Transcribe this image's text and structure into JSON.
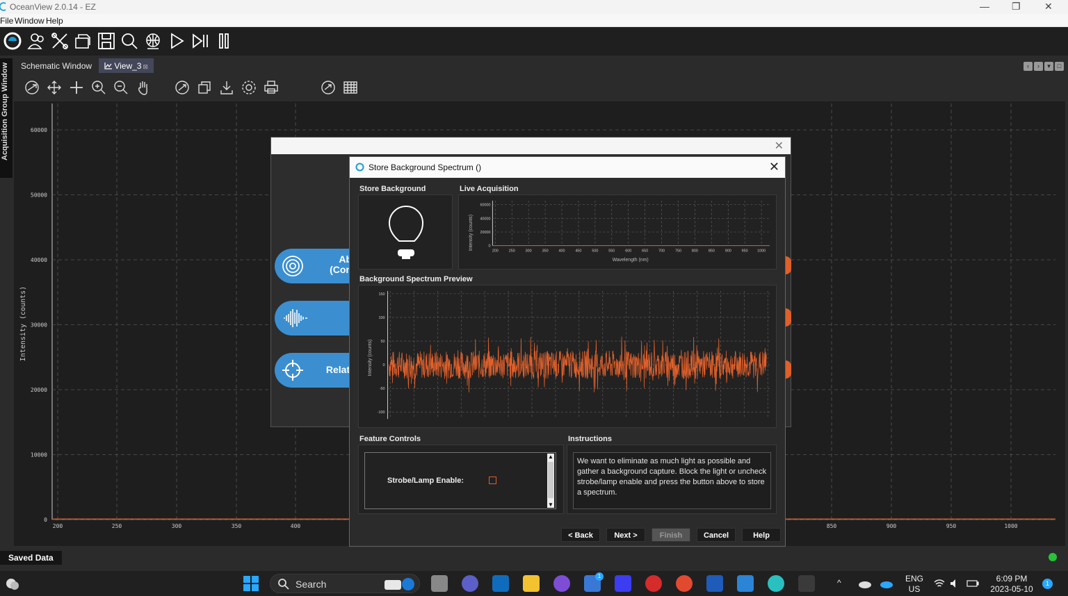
{
  "window": {
    "title": "OceanView 2.0.14  - EZ",
    "minimize": "—",
    "restore": "❐",
    "close": "✕"
  },
  "menu": [
    "File",
    "Window",
    "Help"
  ],
  "left_panel": {
    "label": "Acquisition Group Window"
  },
  "tabs": [
    {
      "label": "Schematic Window"
    },
    {
      "label": "View_3",
      "close": "⊠"
    }
  ],
  "main_chart": {
    "ylabel": "Intensity (counts)",
    "y_ticks": [
      "0",
      "10000",
      "20000",
      "30000",
      "40000",
      "50000",
      "60000"
    ],
    "x_ticks": [
      "200",
      "250",
      "300",
      "350",
      "400",
      "850",
      "900",
      "950",
      "1000"
    ]
  },
  "bg_dialog": {
    "close": "✕",
    "pills": [
      {
        "icon": "target-rings-icon",
        "line1": "Ab",
        "line2": "(Con"
      },
      {
        "icon": "waveform-icon",
        "line1": "",
        "line2": ""
      },
      {
        "icon": "crosshair-icon",
        "line1": "Relati",
        "line2": ""
      }
    ]
  },
  "dialog": {
    "title": "Store Background Spectrum ()",
    "close": "✕",
    "sections": {
      "store_background": "Store Background",
      "live_acquisition": "Live Acquisition",
      "background_preview": "Background Spectrum Preview",
      "feature_controls": "Feature Controls",
      "instructions": "Instructions"
    },
    "live_chart": {
      "ylabel": "Intensity (counts)",
      "xlabel": "Wavelength (nm)",
      "y_ticks": [
        "0",
        "20000",
        "40000",
        "60000"
      ],
      "x_ticks": [
        "200",
        "250",
        "300",
        "350",
        "400",
        "450",
        "500",
        "550",
        "600",
        "650",
        "700",
        "750",
        "800",
        "850",
        "900",
        "950",
        "1000"
      ]
    },
    "preview_chart": {
      "ylabel": "Intensity (counts)",
      "y_ticks": [
        "-100",
        "-50",
        "0",
        "50",
        "100",
        "150"
      ]
    },
    "feature": {
      "label": "Strobe/Lamp Enable:",
      "checked": false,
      "scroll_up": "▲",
      "scroll_down": "▼"
    },
    "instructions_text": "We want to eliminate as much light as possible and gather a background capture. Block the light or uncheck strobe/lamp enable and press the button above to store a spectrum.",
    "buttons": {
      "back": "< Back",
      "next": "Next >",
      "finish": "Finish",
      "cancel": "Cancel",
      "help": "Help"
    }
  },
  "status": {
    "saved_data": "Saved Data"
  },
  "taskbar": {
    "search": "Search",
    "language": "ENG",
    "region": "US",
    "time": "6:09 PM",
    "date": "2023-05-10",
    "notifications": "1",
    "tray_chevron": "^"
  },
  "colors": {
    "accent_blue": "#3b8fd1",
    "spectrum_orange": "#e0602a",
    "status_green": "#27c23a"
  }
}
